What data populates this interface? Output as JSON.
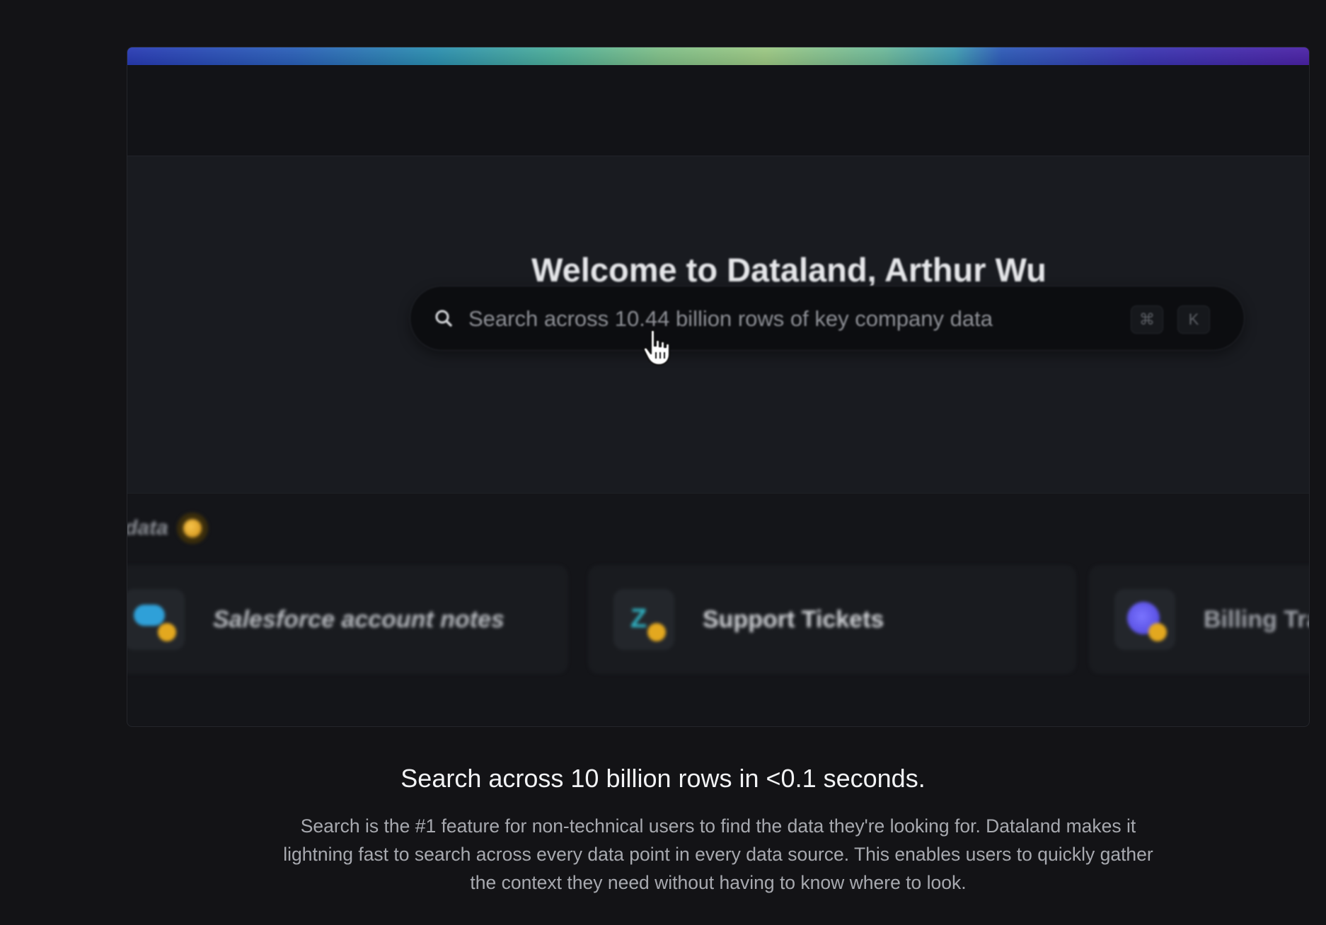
{
  "app": {
    "welcome_title": "Welcome to Dataland, Arthur Wu",
    "search": {
      "placeholder": "Search across 10.44 billion rows of key company data",
      "kbd_keys": [
        "⌘",
        "K"
      ]
    },
    "section": {
      "label": "data",
      "badge_icon": "gold-coin-icon"
    },
    "cards": [
      {
        "title": "Salesforce account notes",
        "icon": "salesforce-cloud-icon"
      },
      {
        "title": "Support Tickets",
        "icon": "zendesk-icon"
      },
      {
        "title": "Billing Trans",
        "icon": "stripe-icon"
      }
    ]
  },
  "caption": {
    "title": "Search across 10 billion rows in <0.1 seconds.",
    "body": "Search is the #1 feature for non-technical users to find the data they're looking for. Dataland makes it lightning fast to search across every data point in every data source. This enables users to quickly gather the context they need without having to know where to look."
  },
  "colors": {
    "page_background": "#131316",
    "accent_gradient": [
      "#283bb4",
      "#4cae9a",
      "#9cc883",
      "#4b22a6"
    ],
    "coin": "#e3a81f"
  }
}
